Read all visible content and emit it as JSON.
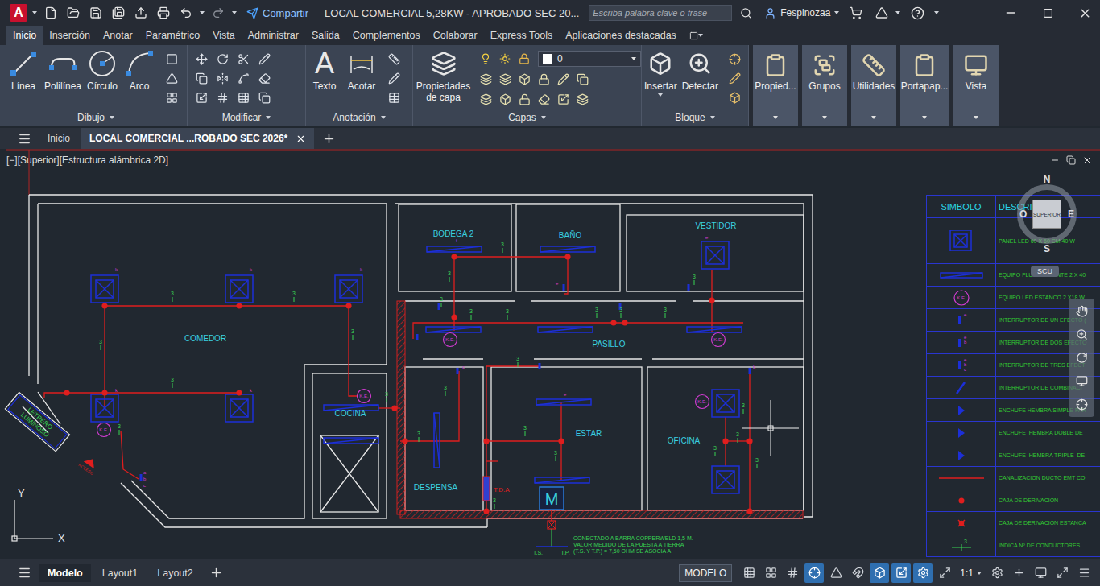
{
  "app": {
    "logo": "A",
    "title": "LOCAL COMERCIAL 5,28KW - APROBADO SEC 20...",
    "share": "Compartir",
    "search_placeholder": "Escriba palabra clave o frase",
    "user": "Fespinozaa"
  },
  "ribbon_tabs": [
    {
      "label": "Inicio",
      "selected": true
    },
    {
      "label": "Inserción",
      "selected": false
    },
    {
      "label": "Anotar",
      "selected": false
    },
    {
      "label": "Paramétrico",
      "selected": false
    },
    {
      "label": "Vista",
      "selected": false
    },
    {
      "label": "Administrar",
      "selected": false
    },
    {
      "label": "Salida",
      "selected": false
    },
    {
      "label": "Complementos",
      "selected": false
    },
    {
      "label": "Colaborar",
      "selected": false
    },
    {
      "label": "Express Tools",
      "selected": false
    },
    {
      "label": "Aplicaciones destacadas",
      "selected": false
    }
  ],
  "ribbon_panels": {
    "draw": {
      "title": "Dibujo",
      "tools": [
        "Línea",
        "Polilínea",
        "Círculo",
        "Arco"
      ]
    },
    "modify": {
      "title": "Modificar"
    },
    "annotation": {
      "title": "Anotación",
      "tools": [
        "Texto",
        "Acotar"
      ],
      "text_glyph": "A"
    },
    "layers": {
      "title": "Capas",
      "tool": "Propiedades de capa",
      "current_layer": "0"
    },
    "block": {
      "title": "Bloque",
      "tools": [
        "Insertar",
        "Detectar"
      ]
    }
  },
  "ribbon_groups": [
    "Propied...",
    "Grupos",
    "Utilidades",
    "Portapap...",
    "Vista"
  ],
  "file_tabs": [
    {
      "label": "Inicio",
      "selected": false
    },
    {
      "label": "LOCAL COMERCIAL ...ROBADO SEC 2026*",
      "selected": true
    }
  ],
  "viewport_label": "[−][Superior][Estructura alámbrica 2D]",
  "plan": {
    "rooms": [
      "COMEDOR",
      "BODEGA 2",
      "BAÑO",
      "VESTIDOR",
      "PASILLO",
      "COCINA",
      "DESPENSA",
      "ESTAR",
      "OFICINA"
    ],
    "sign": [
      "LETRERO",
      "LUMINOSO"
    ],
    "access": "ACCESO",
    "ke_label": "K.E.",
    "conductor_mark": "3",
    "device_tags": [
      "k",
      "k",
      "k",
      "k",
      "k",
      "f",
      "e",
      "c",
      "e",
      "a",
      "b",
      "c",
      "e",
      "b"
    ],
    "board": "M",
    "board_label": "T.D.A",
    "grounds": [
      "T.S.",
      "T.P."
    ],
    "note": [
      "CONECTADO A BARRA COPPERWELD 1,5 M.",
      "VALOR MEDIDO DE LA PUESTA A TIERRA",
      "(T.S. Y T.P.) = 7,50 OHM SE ASOCIA A"
    ]
  },
  "legend": {
    "headers": [
      "SIMBOLO",
      "DESCRIPCI"
    ],
    "rows": [
      {
        "kind": "panel",
        "description": "PANEL LED 60 X 60 CM 40 W"
      },
      {
        "kind": "fluorescent",
        "description": "EQUIPO FLUORESCENTE 2 X 40"
      },
      {
        "kind": "sealed",
        "label": "K.E.",
        "description": "EQUIPO LED ESTANCO 2 X18 W"
      },
      {
        "kind": "switch",
        "marks": [
          "e"
        ],
        "description": "INTERRUPTOR DE UN EFECTO ("
      },
      {
        "kind": "switch",
        "marks": [
          "e",
          "b"
        ],
        "description": "INTERRUPTOR DE DOS EFECTO"
      },
      {
        "kind": "switch",
        "marks": [
          "e",
          "b",
          "c"
        ],
        "description": "INTERRUPTOR DE TRES EFECT"
      },
      {
        "kind": "combination",
        "description": "INTERRUPTOR DE COMBINACI"
      },
      {
        "kind": "outlet",
        "description": "ENCHUFE HEMBRA SIMPLE PAR"
      },
      {
        "kind": "outlet",
        "description": "ENCHUFE  HEMBRA DOBLE DE"
      },
      {
        "kind": "outlet",
        "description": "ENCHUFE  HEMBRA TRIPLE  DE"
      },
      {
        "kind": "duct",
        "description": "CANALIZACION DUCTO EMT CO"
      },
      {
        "kind": "box",
        "description": "CAJA DE DERIVACION"
      },
      {
        "kind": "wetbox",
        "description": "CAJA DE DERIVACION ESTANCA"
      },
      {
        "kind": "count",
        "label": "3",
        "description": "INDICA Nº DE CONDUCTORES"
      }
    ]
  },
  "viewcube": {
    "north": "N",
    "south": "S",
    "west": "O",
    "east": "E",
    "face": "SUPERIOR",
    "ucs": "SCU"
  },
  "ucs_icon": {
    "x": "X",
    "y": "Y"
  },
  "layout_tabs": [
    {
      "label": "Modelo",
      "selected": true
    },
    {
      "label": "Layout1",
      "selected": false
    },
    {
      "label": "Layout2",
      "selected": false
    }
  ],
  "status_bar": {
    "space": "MODELO",
    "scale": "1:1",
    "toggles": [
      {
        "on": false
      },
      {
        "on": false
      },
      {
        "on": false
      },
      {
        "on": true
      },
      {
        "on": false
      },
      {
        "on": false
      },
      {
        "on": true
      },
      {
        "on": true
      },
      {
        "on": true
      },
      {
        "on": false
      }
    ]
  }
}
